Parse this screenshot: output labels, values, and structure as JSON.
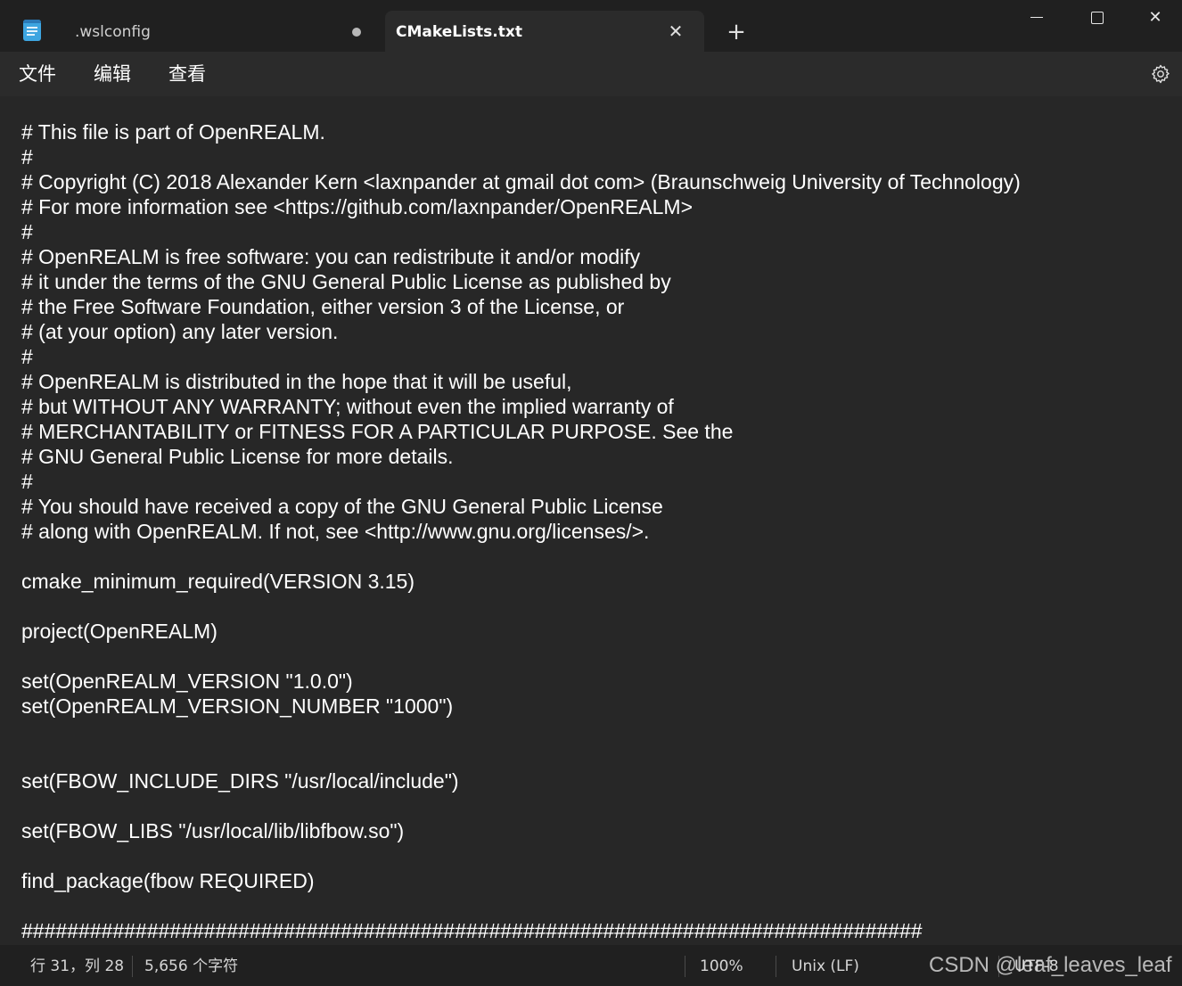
{
  "tabs": [
    {
      "label": ".wslconfig",
      "unsaved": true,
      "active": false
    },
    {
      "label": "CMakeLists.txt",
      "active": true
    }
  ],
  "new_tab_symbol": "+",
  "tab_close_symbol": "✕",
  "window_controls": {
    "close_symbol": "✕"
  },
  "menu": {
    "file": "文件",
    "edit": "编辑",
    "view": "查看"
  },
  "icons": {
    "app": "notepad-icon",
    "settings": "gear-icon"
  },
  "editor": {
    "lines": [
      "# This file is part of OpenREALM.",
      "#",
      "# Copyright (C) 2018 Alexander Kern <laxnpander at gmail dot com> (Braunschweig University of Technology)",
      "# For more information see <https://github.com/laxnpander/OpenREALM>",
      "#",
      "# OpenREALM is free software: you can redistribute it and/or modify",
      "# it under the terms of the GNU General Public License as published by",
      "# the Free Software Foundation, either version 3 of the License, or",
      "# (at your option) any later version.",
      "#",
      "# OpenREALM is distributed in the hope that it will be useful,",
      "# but WITHOUT ANY WARRANTY; without even the implied warranty of",
      "# MERCHANTABILITY or FITNESS FOR A PARTICULAR PURPOSE. See the",
      "# GNU General Public License for more details.",
      "#",
      "# You should have received a copy of the GNU General Public License",
      "# along with OpenREALM. If not, see <http://www.gnu.org/licenses/>.",
      "",
      "cmake_minimum_required(VERSION 3.15)",
      "",
      "project(OpenREALM)",
      "",
      "set(OpenREALM_VERSION \"1.0.0\")",
      "set(OpenREALM_VERSION_NUMBER \"1000\")",
      "",
      "",
      "set(FBOW_INCLUDE_DIRS \"/usr/local/include\")",
      "",
      "set(FBOW_LIBS \"/usr/local/lib/libfbow.so\")",
      "",
      "find_package(fbow REQUIRED)",
      "",
      "###############################################################################"
    ]
  },
  "status": {
    "position": "行 31，列 28",
    "chars": "5,656 个字符",
    "zoom": "100%",
    "line_ending": "Unix (LF)",
    "encoding": "UTF-8"
  },
  "watermark": "CSDN @leaf_leaves_leaf"
}
